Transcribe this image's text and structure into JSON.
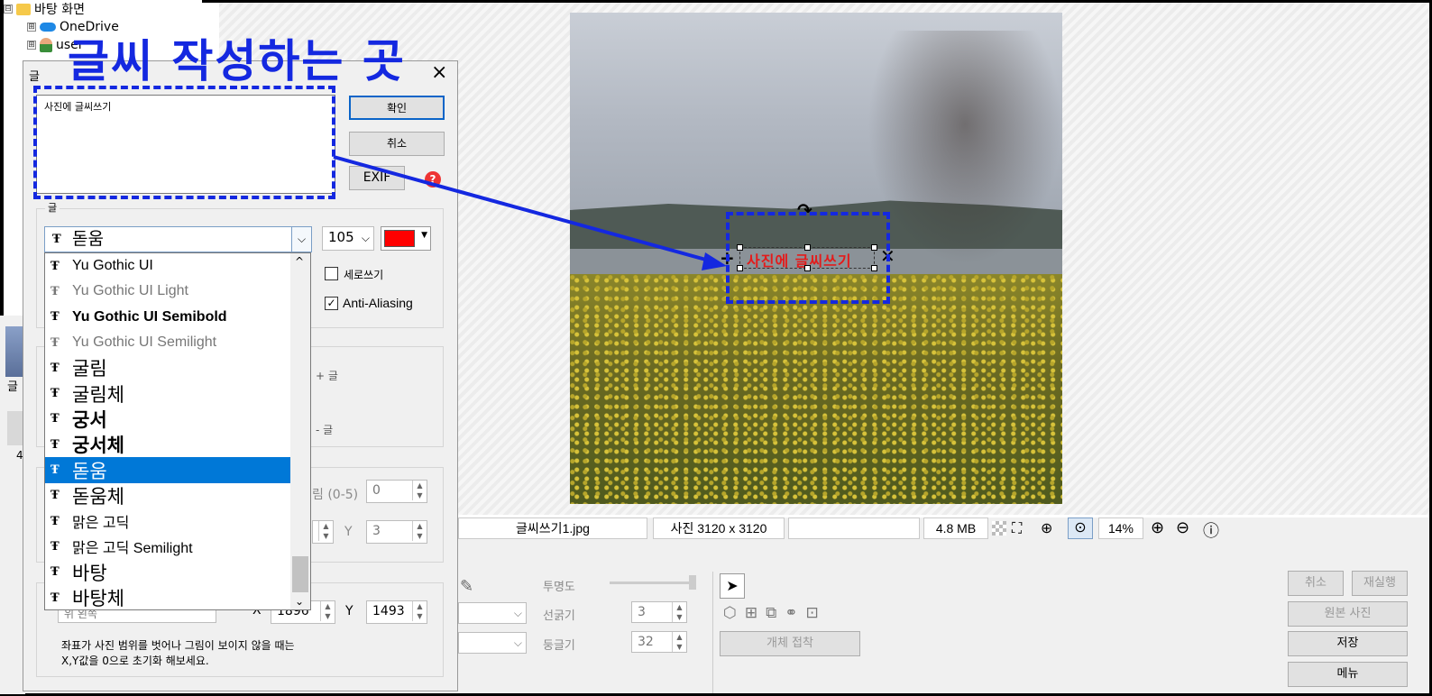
{
  "tree": {
    "items": [
      {
        "label": "바탕 화면",
        "expander": "⊟"
      },
      {
        "label": "OneDrive",
        "expander": "⊞"
      },
      {
        "label": "user",
        "expander": "⊞"
      }
    ]
  },
  "annotation": {
    "title": "글씨 작성하는 곳"
  },
  "dialog": {
    "title": "글",
    "close": "×",
    "text_value": "사진에 글씨쓰기",
    "ok_label": "확인",
    "cancel_label": "취소",
    "exif_label": "EXIF",
    "help": "?",
    "font_group_label": "글",
    "font_selected": "돋움",
    "font_size": "105",
    "font_color": "#ff0000",
    "vertical_label": "세로쓰기",
    "antialias_label": "Anti-Aliasing",
    "vertical_checked": false,
    "antialias_checked": true,
    "plus_label": "+ 글",
    "minus_label": "- 글",
    "round_label": "림 (0-5)",
    "round_value": "0",
    "y_small_label": "Y",
    "y_small_value": "3",
    "pos_select": "위 왼쪽",
    "x_label": "X",
    "x_value": "1896",
    "y_label": "Y",
    "y_value": "1493",
    "note_line1": "좌표가 사진 범위를 벗어나 그림이 보이지 않을 때는",
    "note_line2": "X,Y값을 0으로 초기화 해보세요."
  },
  "font_list": [
    {
      "name": "Yu Gothic UI",
      "style": "normal"
    },
    {
      "name": "Yu Gothic UI Light",
      "style": "light"
    },
    {
      "name": "Yu Gothic UI Semibold",
      "style": "bold"
    },
    {
      "name": "Yu Gothic UI Semilight",
      "style": "light"
    },
    {
      "name": "굴림",
      "style": "big"
    },
    {
      "name": "굴림체",
      "style": "big"
    },
    {
      "name": "궁서",
      "style": "big-bold"
    },
    {
      "name": "궁서체",
      "style": "big-bold"
    },
    {
      "name": "돋움",
      "style": "big-selected"
    },
    {
      "name": "돋움체",
      "style": "big"
    },
    {
      "name": "맑은 고딕",
      "style": "normal"
    },
    {
      "name": "맑은 고딕 Semilight",
      "style": "normal"
    },
    {
      "name": "바탕",
      "style": "big"
    },
    {
      "name": "바탕체",
      "style": "big"
    }
  ],
  "photo": {
    "overlay_text": "사진에 글씨쓰기"
  },
  "status": {
    "filename": "글씨쓰기1.jpg",
    "dimensions": "사진 3120 x 3120",
    "size": "4.8 MB",
    "zoom": "14%"
  },
  "bottom": {
    "opacity_label": "투명도",
    "line_label": "선굵기",
    "line_value": "3",
    "round_label": "둥글기",
    "round_value": "32",
    "attach_label": "개체 접착",
    "cancel": "취소",
    "redo": "재실행",
    "original": "원본 사진",
    "save": "저장",
    "menu": "메뉴"
  },
  "left_label": "글",
  "left_num": "4",
  "colors": {
    "annotation": "#1428e0",
    "selected": "#0078d7",
    "overlay": "#e41b1b"
  }
}
